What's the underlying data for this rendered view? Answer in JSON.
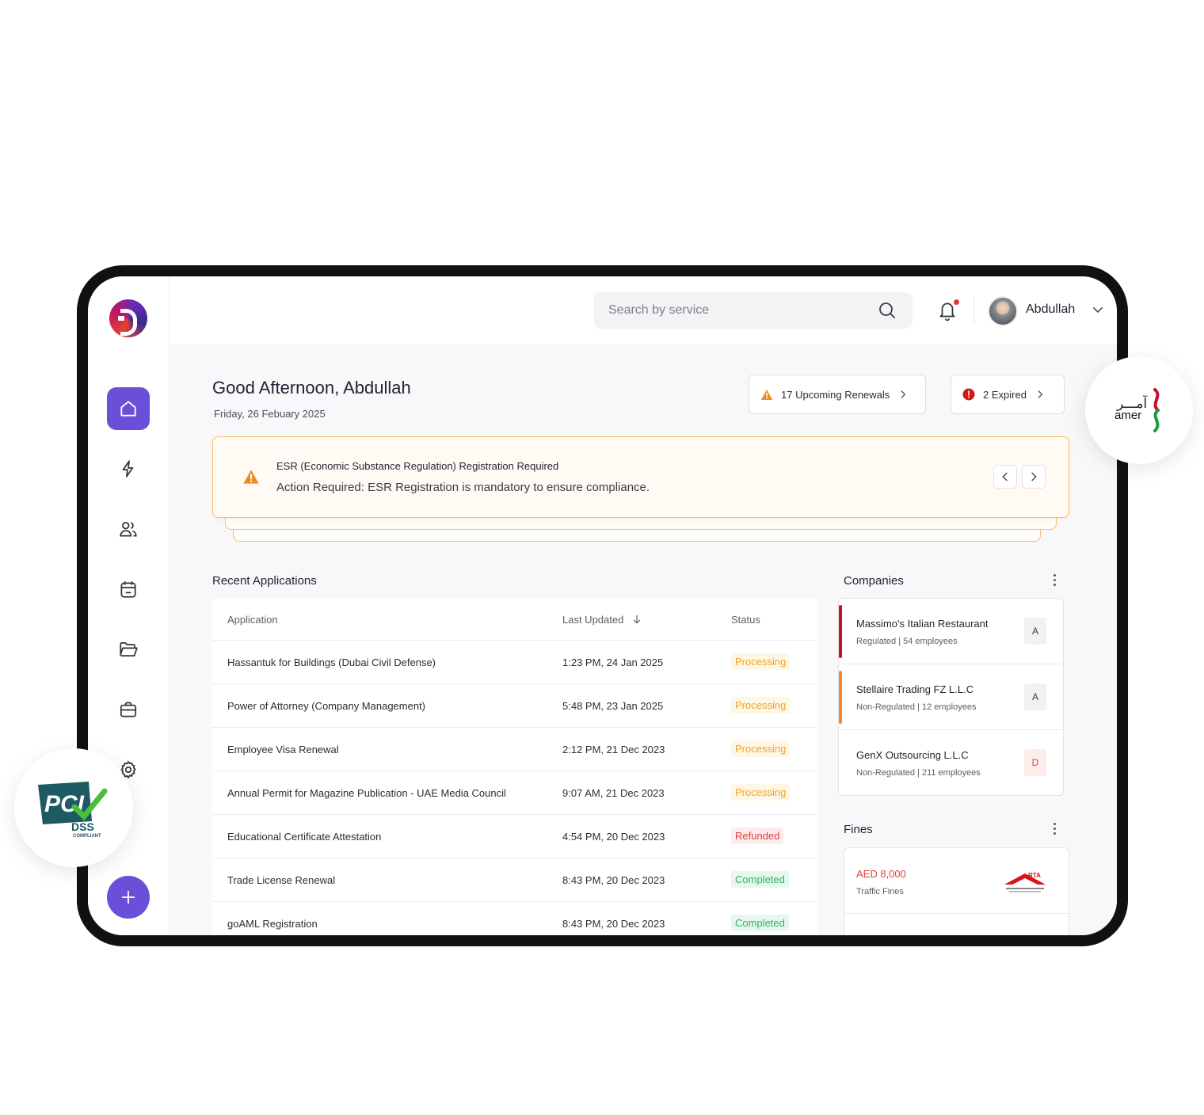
{
  "topbar": {
    "search_placeholder": "Search by service",
    "user_name": "Abdullah"
  },
  "sidebar": {
    "items": [
      {
        "name": "home",
        "active": true
      },
      {
        "name": "lightning"
      },
      {
        "name": "users"
      },
      {
        "name": "calendar"
      },
      {
        "name": "folder"
      },
      {
        "name": "briefcase"
      },
      {
        "name": "settings"
      }
    ]
  },
  "header": {
    "greeting": "Good Afternoon, Abdullah",
    "date": "Friday, 26 Febuary 2025",
    "renewals_label": "17 Upcoming Renewals",
    "expired_label": "2 Expired"
  },
  "alert": {
    "title": "ESR (Economic Substance Regulation) Registration Required",
    "message": "Action Required: ESR Registration is mandatory to ensure compliance."
  },
  "recent_applications": {
    "title": "Recent Applications",
    "columns": [
      "Application",
      "Last Updated",
      "Status"
    ],
    "rows": [
      {
        "application": "Hassantuk for Buildings (Dubai Civil Defense)",
        "updated": "1:23 PM, 24 Jan 2025",
        "status": "Processing"
      },
      {
        "application": "Power of Attorney (Company Management)",
        "updated": "5:48 PM, 23 Jan 2025",
        "status": "Processing"
      },
      {
        "application": "Employee Visa Renewal",
        "updated": "2:12 PM, 21 Dec 2023",
        "status": "Processing"
      },
      {
        "application": "Annual Permit for Magazine Publication - UAE Media Council",
        "updated": "9:07 AM, 21 Dec 2023",
        "status": "Processing"
      },
      {
        "application": "Educational Certificate Attestation",
        "updated": "4:54 PM, 20 Dec 2023",
        "status": "Refunded"
      },
      {
        "application": "Trade License Renewal",
        "updated": "8:43 PM, 20 Dec 2023",
        "status": "Completed"
      },
      {
        "application": "goAML Registration",
        "updated": "8:43 PM, 20 Dec 2023",
        "status": "Completed"
      }
    ]
  },
  "companies": {
    "title": "Companies",
    "items": [
      {
        "name": "Massimo's Italian Restaurant",
        "meta": "Regulated | 54 employees",
        "grade": "A",
        "accent": "#c8102e"
      },
      {
        "name": "Stellaire Trading FZ L.L.C",
        "meta": "Non-Regulated |  12 employees",
        "grade": "A",
        "accent": "#f08a24"
      },
      {
        "name": "GenX Outsourcing L.L.C",
        "meta": "Non-Regulated | 211 employees",
        "grade": "D",
        "accent": ""
      }
    ]
  },
  "fines": {
    "title": "Fines",
    "items": [
      {
        "amount": "AED 8,000",
        "type": "Traffic Fines",
        "logo": "RTA"
      }
    ]
  },
  "badges": {
    "amer_ar": "آمـــر",
    "amer_en": "amer",
    "pci": "PCI",
    "dss": "DSS",
    "compliant": "COMPLIANT"
  },
  "colors": {
    "accent": "#6b4fd8",
    "processing": "#f0a323",
    "refunded": "#e0403f",
    "completed": "#2bb36a"
  }
}
